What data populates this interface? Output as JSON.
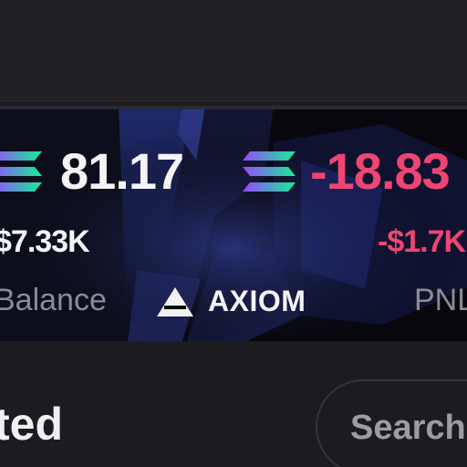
{
  "card": {
    "balance": {
      "amount": "81.17",
      "usd": "$7.33K",
      "label": "Balance"
    },
    "pnl": {
      "amount": "-18.83",
      "usd": "-$1.7K",
      "label": "PNL"
    },
    "brand": "AXIOM"
  },
  "section": {
    "heading": "ted"
  },
  "search": {
    "placeholder": "Search"
  },
  "colors": {
    "positive": "#f4f4f6",
    "negative": "#ef4573",
    "muted": "#8a8b93"
  },
  "icons": [
    "solana-icon",
    "axiom-logo-icon"
  ]
}
